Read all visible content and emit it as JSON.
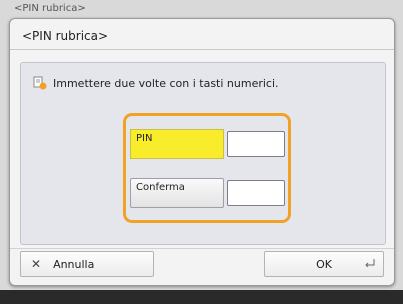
{
  "background": {
    "title": "<PIN rubrica>"
  },
  "dialog": {
    "title": "<PIN rubrica>",
    "instruction": "Immettere due volte con i tasti numerici.",
    "instruction_icon": "info-icon",
    "fields": [
      {
        "label": "PIN",
        "value": ""
      },
      {
        "label": "Conferma",
        "value": ""
      }
    ]
  },
  "buttons": {
    "cancel_label": "Annulla",
    "cancel_icon": "close-icon",
    "ok_label": "OK",
    "ok_icon": "enter-icon"
  },
  "colors": {
    "accent_orange": "#f0a226",
    "selected_yellow": "#f9ec2a"
  }
}
